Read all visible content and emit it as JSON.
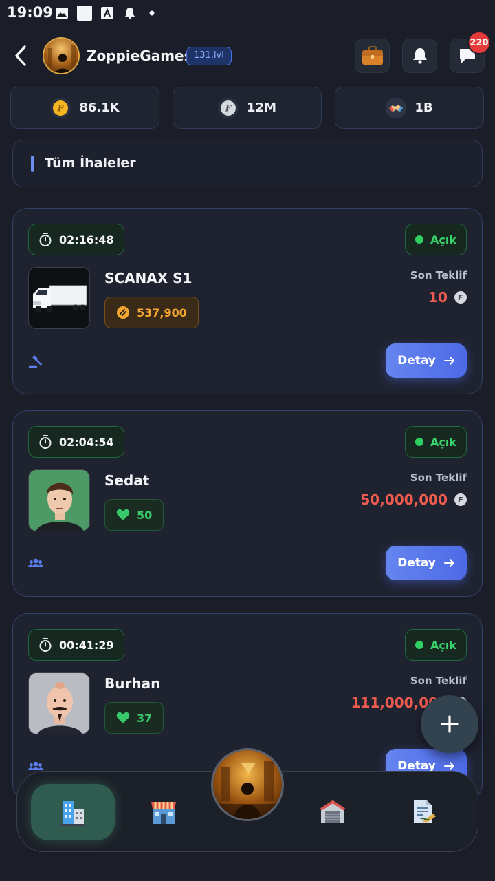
{
  "status_bar": {
    "time": "19:09"
  },
  "header": {
    "username": "ZoppieGames",
    "level": "131.lvl",
    "notification_count": "220"
  },
  "currencies": [
    {
      "icon": "gold-coin-icon",
      "value": "86.1K",
      "color": "#f5b622"
    },
    {
      "icon": "silver-coin-icon",
      "value": "12M",
      "color": "#d6d9df"
    },
    {
      "icon": "handshake-icon",
      "value": "1B",
      "color": "#2d3445"
    }
  ],
  "filter": {
    "label": "Tüm İhaleler"
  },
  "auctions": [
    {
      "timer": "02:16:48",
      "status": "Açık",
      "name": "SCANAX S1",
      "chip_value": "537,900",
      "chip_kind": "price",
      "last_bid_label": "Son Teklif",
      "last_bid": "10",
      "kind_icon": "gavel-icon",
      "detail_label": "Detay"
    },
    {
      "timer": "02:04:54",
      "status": "Açık",
      "name": "Sedat",
      "chip_value": "50",
      "chip_kind": "likes",
      "last_bid_label": "Son Teklif",
      "last_bid": "50,000,000",
      "kind_icon": "group-icon",
      "detail_label": "Detay"
    },
    {
      "timer": "00:41:29",
      "status": "Açık",
      "name": "Burhan",
      "chip_value": "37",
      "chip_kind": "likes",
      "last_bid_label": "Son Teklif",
      "last_bid": "111,000,000",
      "kind_icon": "group-icon",
      "detail_label": "Detay"
    }
  ],
  "colors": {
    "accent": "#5a78ec",
    "success": "#2fcf62",
    "bid": "#ef5b4e",
    "warning": "#f4a631"
  },
  "nav": [
    {
      "icon": "office-building-icon",
      "active": true
    },
    {
      "icon": "market-store-icon",
      "active": false
    },
    {
      "icon": "home-avatar-icon",
      "active": false
    },
    {
      "icon": "garage-icon",
      "active": false
    },
    {
      "icon": "contract-document-icon",
      "active": false
    }
  ]
}
